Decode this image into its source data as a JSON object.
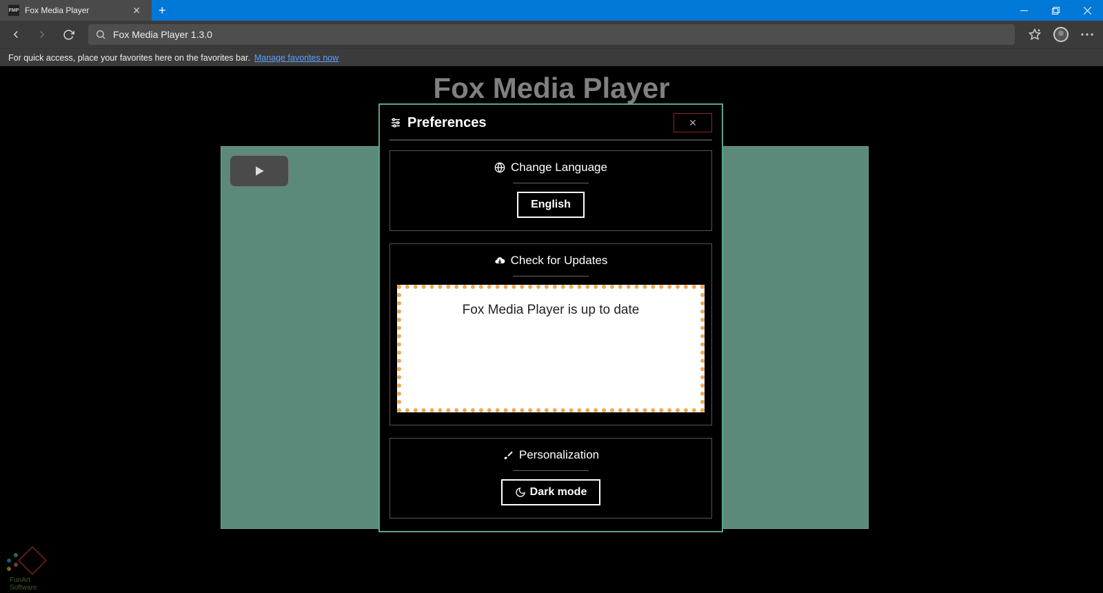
{
  "browser": {
    "tab_title": "Fox Media Player",
    "tab_favicon_text": "FMP",
    "address": "Fox Media Player 1.3.0",
    "bookmarks_msg": "For quick access, place your favorites here on the favorites bar.",
    "bookmarks_link": "Manage favorites now"
  },
  "app": {
    "title": "Fox Media Player"
  },
  "modal": {
    "title": "Preferences",
    "close": "✕",
    "sections": {
      "language": {
        "header": "Change Language",
        "value": "English"
      },
      "updates": {
        "header": "Check for Updates",
        "status": "Fox Media Player is up to date"
      },
      "personalization": {
        "header": "Personalization",
        "mode": "Dark mode"
      }
    }
  },
  "logo": {
    "text": "FunArt Software"
  }
}
